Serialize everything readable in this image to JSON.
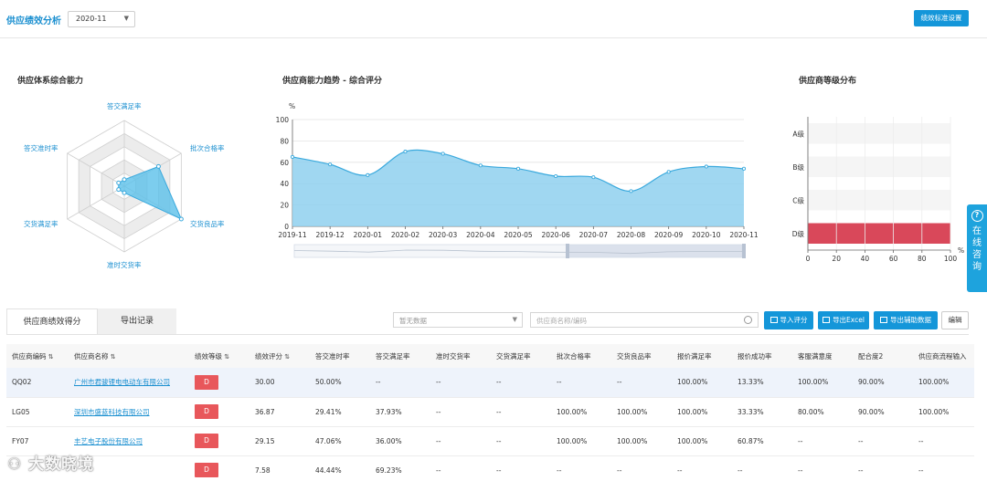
{
  "header": {
    "title": "供应绩效分析",
    "month_value": "2020-11",
    "standard_button": "绩效标准设置"
  },
  "radar": {
    "title": "供应体系综合能力",
    "labels": [
      "答交满足率",
      "批次合格率",
      "交货良品率",
      "准时交货率",
      "交货满足率",
      "答交准时率"
    ],
    "values": [
      0.1,
      0.6,
      1.0,
      0.1,
      0.1,
      0.1
    ],
    "fill": "#5bc0ea"
  },
  "trend": {
    "title": "供应商能力趋势 - 综合评分",
    "unit": "%"
  },
  "grade": {
    "title": "供应商等级分布",
    "unit": "%"
  },
  "chart_data": [
    {
      "type": "area",
      "title": "供应商能力趋势 - 综合评分",
      "ylabel": "%",
      "categories": [
        "2019-11",
        "2019-12",
        "2020-01",
        "2020-02",
        "2020-03",
        "2020-04",
        "2020-05",
        "2020-06",
        "2020-07",
        "2020-08",
        "2020-09",
        "2020-10",
        "2020-11"
      ],
      "values": [
        65,
        58,
        48,
        70,
        68,
        57,
        54,
        47,
        46,
        33,
        51,
        56,
        54
      ],
      "ylim": [
        0,
        100
      ],
      "yticks": [
        0,
        20,
        40,
        60,
        80,
        100
      ],
      "grid": true,
      "color": "#8fd0ef"
    },
    {
      "type": "bar",
      "orientation": "horizontal",
      "title": "供应商等级分布",
      "categories": [
        "A级",
        "B级",
        "C级",
        "D级"
      ],
      "values": [
        0,
        0,
        0,
        100
      ],
      "xlim": [
        0,
        100
      ],
      "xticks": [
        0,
        20,
        40,
        60,
        80,
        100
      ],
      "xlabel": "%",
      "color": "#d9485a"
    }
  ],
  "consult": {
    "label": "在线咨询",
    "chars": [
      "在",
      "线",
      "咨",
      "询"
    ]
  },
  "tabs": [
    {
      "label": "供应商绩效得分",
      "active": true
    },
    {
      "label": "导出记录",
      "active": false
    }
  ],
  "toolbar": {
    "nodata_placeholder": "暂无数据",
    "search_placeholder": "供应商名称/编码",
    "import_label": "导入评分",
    "export_excel_label": "导出Excel",
    "export_aux_label": "导出辅助数据",
    "edit_label": "编辑"
  },
  "table": {
    "columns": [
      "供应商编码",
      "供应商名称",
      "绩效等级",
      "绩效评分",
      "答交准时率",
      "答交满足率",
      "准时交货率",
      "交货满足率",
      "批次合格率",
      "交货良品率",
      "报价满足率",
      "报价成功率",
      "客服满意度",
      "配合度2",
      "供应商流程输入"
    ],
    "rows": [
      [
        "QQ02",
        "广州市君骏锂电电动车有限公司",
        "D",
        "30.00",
        "50.00%",
        "--",
        "--",
        "--",
        "--",
        "--",
        "100.00%",
        "13.33%",
        "100.00%",
        "90.00%",
        "100.00%"
      ],
      [
        "LG05",
        "深圳市盛蓝科技有限公司",
        "D",
        "36.87",
        "29.41%",
        "37.93%",
        "--",
        "--",
        "100.00%",
        "100.00%",
        "100.00%",
        "33.33%",
        "80.00%",
        "90.00%",
        "100.00%"
      ],
      [
        "FY07",
        "丰艺电子股份有限公司",
        "D",
        "29.15",
        "47.06%",
        "36.00%",
        "--",
        "--",
        "100.00%",
        "100.00%",
        "100.00%",
        "60.87%",
        "--",
        "--",
        "--"
      ],
      [
        "",
        "",
        "D",
        "7.58",
        "44.44%",
        "69.23%",
        "--",
        "--",
        "--",
        "--",
        "--",
        "--",
        "--",
        "--",
        "--"
      ]
    ],
    "sortable": [
      true,
      true,
      true,
      true,
      false,
      false,
      false,
      false,
      false,
      false,
      false,
      false,
      false,
      false,
      false
    ]
  },
  "watermark": "大数晓境"
}
